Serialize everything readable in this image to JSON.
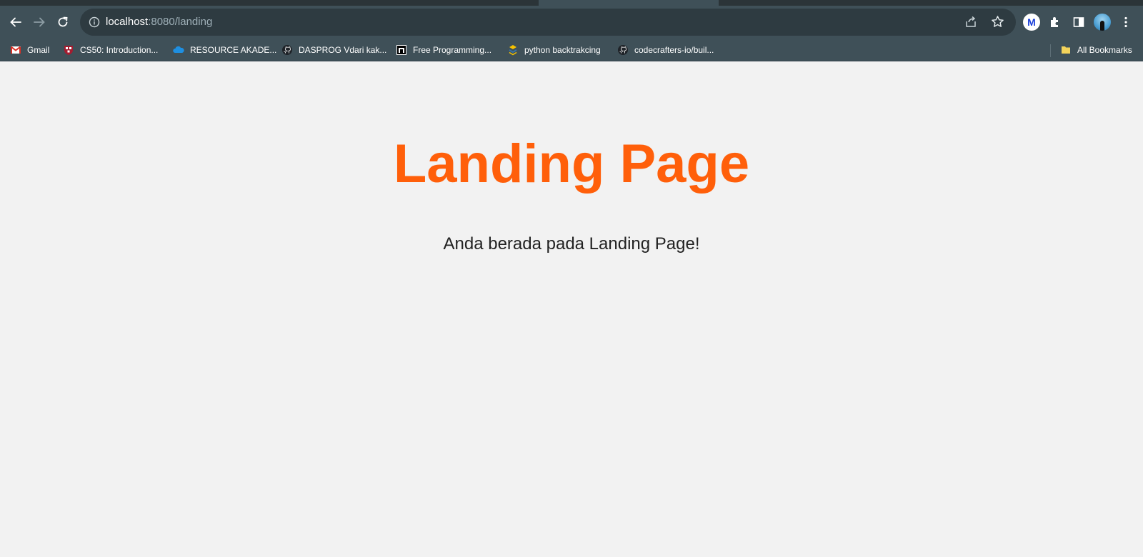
{
  "browser": {
    "url_host": "localhost",
    "url_path": ":8080/landing",
    "bookmarks": [
      {
        "label": "Gmail",
        "icon": "gmail-icon"
      },
      {
        "label": "CS50: Introduction...",
        "icon": "harvard-shield-icon"
      },
      {
        "label": "RESOURCE AKADE...",
        "icon": "onedrive-cloud-icon"
      },
      {
        "label": "DASPROG Vdari kak...",
        "icon": "github-icon"
      },
      {
        "label": "Free Programming...",
        "icon": "site-favicon-icon"
      },
      {
        "label": "python backtrakcing",
        "icon": "python-icon"
      },
      {
        "label": "codecrafters-io/buil...",
        "icon": "github-icon"
      }
    ],
    "all_bookmarks_label": "All Bookmarks"
  },
  "page": {
    "title": "Landing Page",
    "message": "Anda berada pada Landing Page!"
  },
  "colors": {
    "accent": "#ff5f0a",
    "background": "#f2f2f2",
    "toolbar": "#3f5058"
  }
}
